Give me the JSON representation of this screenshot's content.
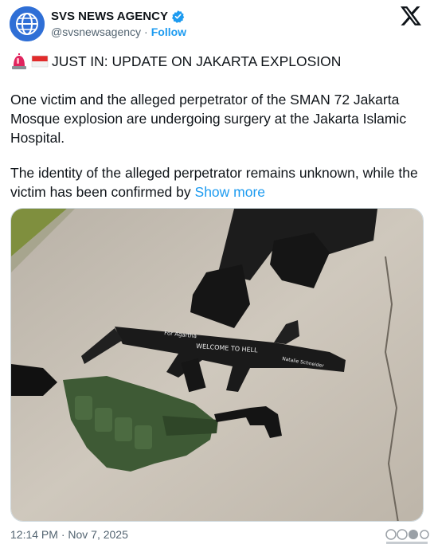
{
  "account": {
    "display_name": "SVS NEWS AGENCY",
    "handle": "@svsnewsagency",
    "separator": "·",
    "follow_label": "Follow",
    "verified": true,
    "avatar_icon": "globe-icon"
  },
  "platform": {
    "logo_icon": "x-logo-icon"
  },
  "tweet": {
    "headline": "JUST IN: UPDATE ON JAKARTA EXPLOSION",
    "headline_emojis": [
      "rotating-light-icon",
      "indonesia-flag-icon"
    ],
    "paragraph_1": "One victim and the alleged perpetrator of the SMAN 72 Jakarta Mosque explosion are undergoing surgery at the Jakarta Islamic Hospital.",
    "paragraph_2": "The identity of the alleged perpetrator remains unknown, while the victim has been confirmed by",
    "show_more_label": "Show more"
  },
  "media": {
    "description_icon": "photo-icon",
    "weapon_writing_1": "For Agartha",
    "weapon_writing_2": "WELCOME TO HELL",
    "weapon_writing_3": "Natalie Schneider"
  },
  "meta": {
    "timestamp": "12:14 PM · Nov 7, 2025"
  },
  "colors": {
    "link": "#1d9bf0",
    "secondary_text": "#536471",
    "verified_badge": "#1d9bf0",
    "avatar_bg": "#2f6fd6"
  }
}
